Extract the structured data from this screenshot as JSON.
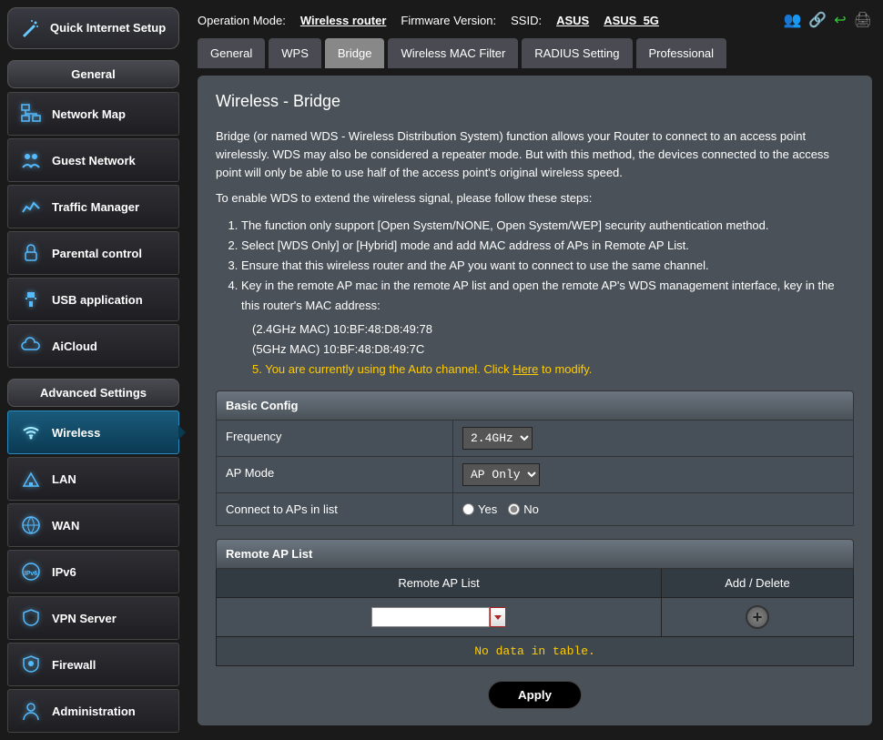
{
  "qis_label": "Quick Internet Setup",
  "sidebar": {
    "general_header": "General",
    "advanced_header": "Advanced Settings",
    "general_items": [
      "Network Map",
      "Guest Network",
      "Traffic Manager",
      "Parental control",
      "USB application",
      "AiCloud"
    ],
    "advanced_items": [
      "Wireless",
      "LAN",
      "WAN",
      "IPv6",
      "VPN Server",
      "Firewall",
      "Administration"
    ]
  },
  "topbar": {
    "op_mode_label": "Operation Mode:",
    "op_mode_value": "Wireless router",
    "fw_label": "Firmware Version:",
    "ssid_label": "SSID:",
    "ssid1": "ASUS",
    "ssid2": "ASUS_5G"
  },
  "tabs": [
    "General",
    "WPS",
    "Bridge",
    "Wireless MAC Filter",
    "RADIUS Setting",
    "Professional"
  ],
  "active_tab": "Bridge",
  "content": {
    "title": "Wireless - Bridge",
    "desc1": "Bridge (or named WDS - Wireless Distribution System) function allows your Router to connect to an access point wirelessly. WDS may also be considered a repeater mode. But with this method, the devices connected to the access point will only be able to use half of the access point's original wireless speed.",
    "desc2": "To enable WDS to extend the wireless signal, please follow these steps:",
    "steps": [
      "The function only support [Open System/NONE, Open System/WEP] security authentication method.",
      "Select [WDS Only] or [Hybrid] mode and add MAC address of APs in Remote AP List.",
      "Ensure that this wireless router and the AP you want to connect to use the same channel.",
      "Key in the remote AP mac in the remote AP list and open the remote AP's WDS management interface, key in the this router's MAC address:"
    ],
    "mac_24": "(2.4GHz MAC) 10:BF:48:D8:49:78",
    "mac_5": "(5GHz MAC) 10:BF:48:D8:49:7C",
    "warn_prefix": "5. You are currently using the Auto channel. Click ",
    "warn_link": "Here",
    "warn_suffix": " to modify.",
    "basic_config_header": "Basic Config",
    "freq_label": "Frequency",
    "freq_value": "2.4GHz",
    "ap_mode_label": "AP Mode",
    "ap_mode_value": "AP Only",
    "connect_label": "Connect to APs in list",
    "yes": "Yes",
    "no": "No",
    "remote_ap_header": "Remote AP List",
    "remote_ap_col": "Remote AP List",
    "add_delete_col": "Add / Delete",
    "no_data": "No data in table.",
    "apply": "Apply"
  }
}
